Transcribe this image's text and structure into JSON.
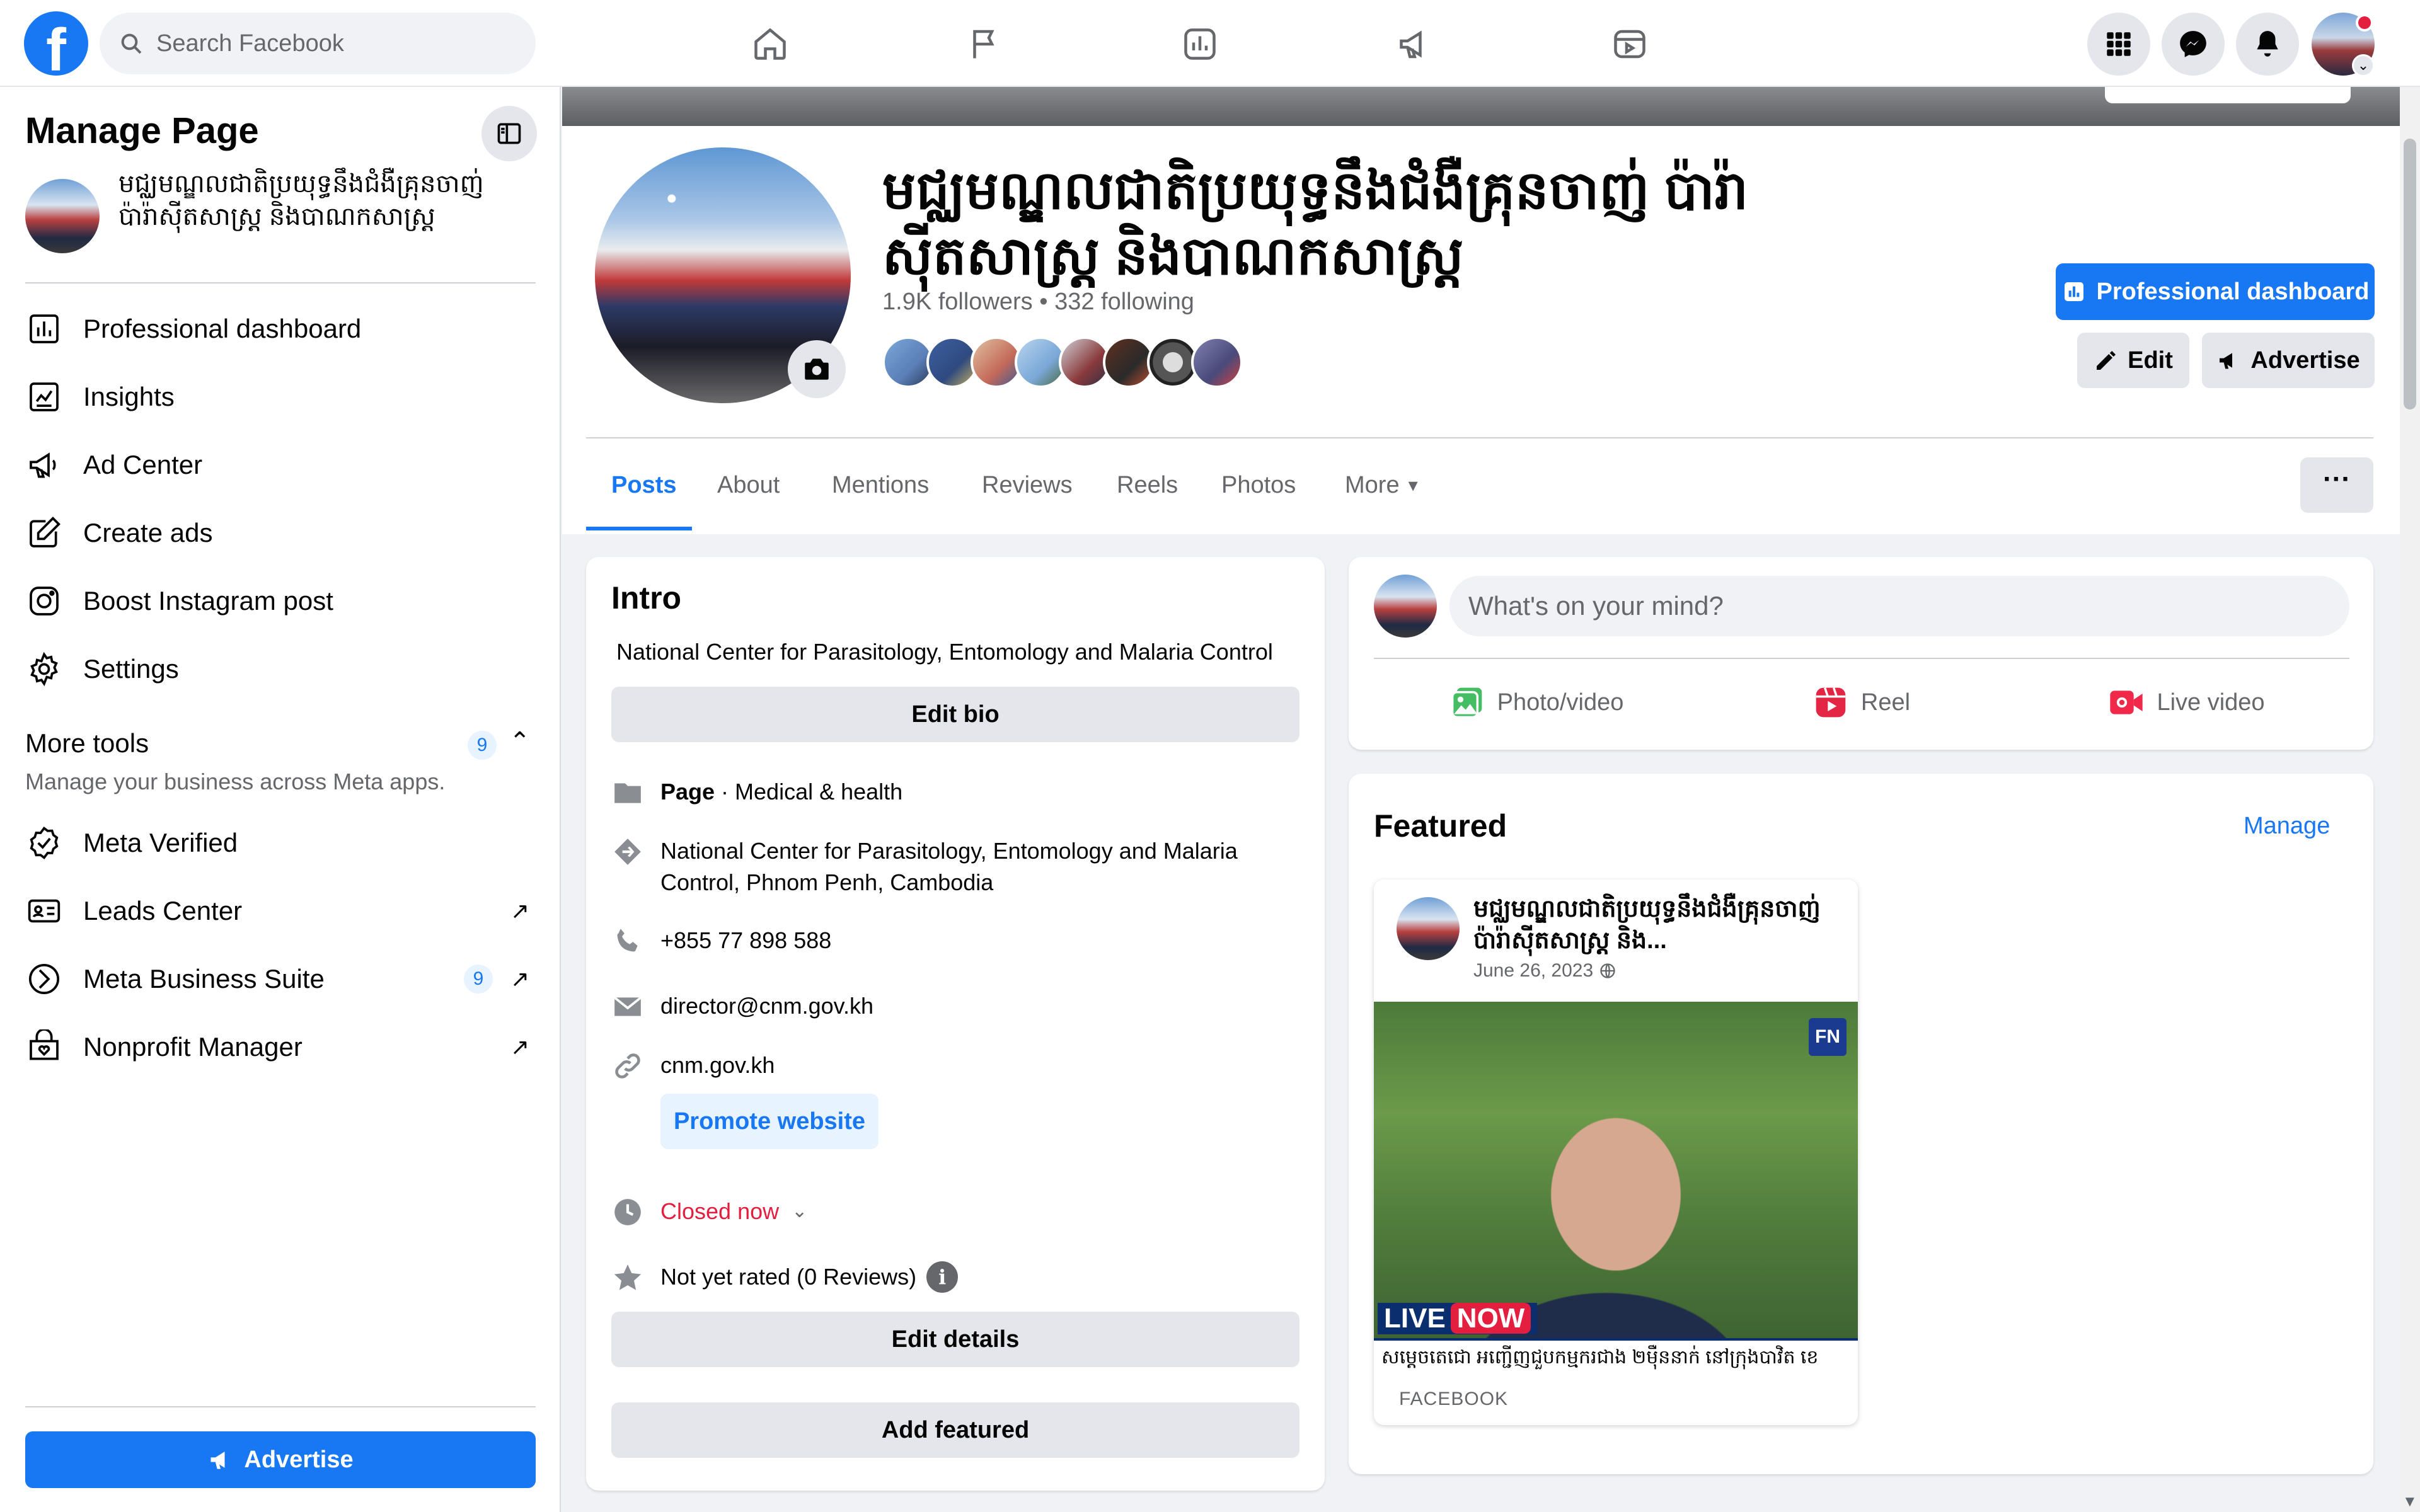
{
  "topbar": {
    "logo_letter": "f",
    "search_placeholder": "Search Facebook",
    "nav_icons": [
      "home-icon",
      "flag-icon",
      "insights-icon",
      "megaphone-icon",
      "video-icon"
    ],
    "right_icons": [
      "menu-grid-icon",
      "messenger-icon",
      "bell-icon"
    ],
    "avatar_chevron": "⌄"
  },
  "sidebar": {
    "title": "Manage Page",
    "page_name": "មជ្ឈមណ្ឌលជាតិប្រយុទ្ធនឹងជំងឺគ្រុនចាញ់ ប៉ារ៉ាស៊ីតសាស្ត្រ និងបាណកសាស្ត្រ",
    "items": [
      {
        "label": "Professional dashboard",
        "icon": "dashboard-icon"
      },
      {
        "label": "Insights",
        "icon": "insights-icon"
      },
      {
        "label": "Ad Center",
        "icon": "megaphone-icon"
      },
      {
        "label": "Create ads",
        "icon": "pencil-square-icon"
      },
      {
        "label": "Boost Instagram post",
        "icon": "instagram-icon"
      },
      {
        "label": "Settings",
        "icon": "gear-icon"
      }
    ],
    "more_tools": {
      "title": "More tools",
      "badge": "9",
      "chevron": "⌃",
      "subtitle": "Manage your business across Meta apps."
    },
    "tools": [
      {
        "label": "Meta Verified",
        "icon": "verified-icon",
        "badge": "",
        "external": ""
      },
      {
        "label": "Leads Center",
        "icon": "leads-icon",
        "badge": "",
        "external": "↗"
      },
      {
        "label": "Meta Business Suite",
        "icon": "business-suite-icon",
        "badge": "9",
        "external": "↗"
      },
      {
        "label": "Nonprofit Manager",
        "icon": "nonprofit-icon",
        "badge": "",
        "external": "↗"
      }
    ],
    "advertise_label": "Advertise"
  },
  "profile": {
    "title": "មជ្ឈមណ្ឌលជាតិប្រយុទ្ធនឹងជំងឺគ្រុនចាញ់ ប៉ារ៉ាស៊ីតសាស្ត្រ និងបាណកសាស្ត្រ",
    "followers": "1.9K followers",
    "separator": " • ",
    "following": "332 following",
    "friend_avatar_colors": [
      "#5b7fb8",
      "#3d5fa0",
      "#c46a5a",
      "#7aa8d8",
      "#8a3a3a",
      "#2a2a2a",
      "#555555",
      "#4a4a7a"
    ],
    "buttons": {
      "professional_dashboard": "Professional dashboard",
      "edit": "Edit",
      "advertise": "Advertise"
    },
    "tabs": [
      "Posts",
      "About",
      "Mentions",
      "Reviews",
      "Reels",
      "Photos",
      "More"
    ],
    "more_caret": "▾",
    "overflow": "···"
  },
  "intro": {
    "title": "Intro",
    "bio": "National Center for Parasitology, Entomology and Malaria Control",
    "edit_bio": "Edit bio",
    "category_prefix": "Page",
    "category": " · Medical & health",
    "address": "National Center for Parasitology, Entomology and Malaria Control, Phnom Penh, Cambodia",
    "phone": "+855 77 898 588",
    "email": "director@cnm.gov.kh",
    "website": "cnm.gov.kh",
    "promote_website": "Promote website",
    "hours": "Closed now",
    "hours_caret": "⌄",
    "rating": "Not yet rated (0 Reviews)",
    "edit_details": "Edit details",
    "add_featured": "Add featured"
  },
  "composer": {
    "placeholder": "What's on your mind?",
    "actions": [
      {
        "label": "Photo/video",
        "icon": "photo-icon",
        "color": "#45bd62"
      },
      {
        "label": "Reel",
        "icon": "reel-icon",
        "color": "#e42645"
      },
      {
        "label": "Live video",
        "icon": "live-video-icon",
        "color": "#f02849"
      }
    ]
  },
  "featured": {
    "title": "Featured",
    "manage": "Manage",
    "post": {
      "author": "មជ្ឈមណ្ឌលជាតិប្រយុទ្ធនឹងជំងឺគ្រុនចាញ់ ប៉ារ៉ាស៊ីតសាស្ត្រ និង...",
      "date": "June 26, 2023",
      "privacy_icon": "globe-icon",
      "live_label": "LIVE",
      "now_label": "NOW",
      "ticker": "សម្តេចតេជោ អញ្ជើញជួបកម្មករជាង ២ម៉ឺននាក់ នៅក្រុងបាវិត ខេ",
      "channel_logo": "FN",
      "source": "FACEBOOK"
    }
  },
  "colors": {
    "brand": "#1877f2",
    "page_bg": "#f0f2f5",
    "text_secondary": "#65676b",
    "danger": "#e41e3f"
  }
}
